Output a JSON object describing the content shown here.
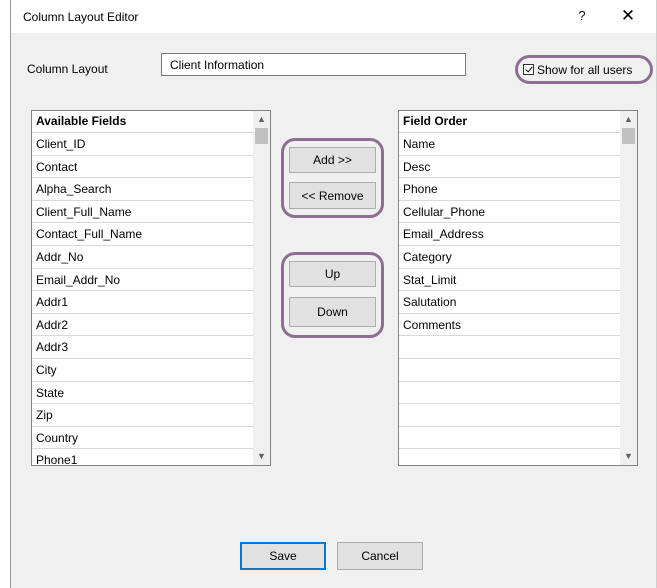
{
  "window": {
    "title": "Column Layout Editor",
    "help_label": "?",
    "close_label": "✕"
  },
  "layout": {
    "label": "Column Layout",
    "value": "Client Information",
    "show_all_label": "Show for all users",
    "show_all_checked": true
  },
  "available": {
    "header": "Available Fields",
    "items": [
      "Client_ID",
      "Contact",
      "Alpha_Search",
      "Client_Full_Name",
      "Contact_Full_Name",
      "Addr_No",
      "Email_Addr_No",
      "Addr1",
      "Addr2",
      "Addr3",
      "City",
      "State",
      "Zip",
      "Country",
      "Phone1"
    ]
  },
  "order": {
    "header": "Field Order",
    "items": [
      "Name",
      "Desc",
      "Phone",
      "Cellular_Phone",
      "Email_Address",
      "Category",
      "Stat_Limit",
      "Salutation",
      "Comments",
      "",
      "",
      "",
      "",
      "",
      ""
    ]
  },
  "buttons": {
    "add": "Add  >>",
    "remove": "<<  Remove",
    "up": "Up",
    "down": "Down",
    "save": "Save",
    "cancel": "Cancel"
  },
  "scroll_icons": {
    "up": "▲",
    "down": "▼"
  },
  "colors": {
    "highlight_ring": "#8e6f93",
    "default_button_border": "#0078d7"
  }
}
